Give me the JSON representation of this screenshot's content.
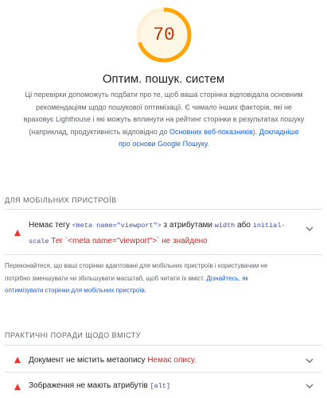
{
  "gauge": {
    "score": "70",
    "score_fraction": 0.7,
    "color": "#ffa400"
  },
  "category": {
    "title": "Оптим. пошук. систем",
    "description_before_link": "Ці перевірки допоможуть подбати про те, щоб ваша сторінка відповідала основним рекомендаціям щодо пошукової оптимізації. Є чимало інших факторів, які не враховує Lighthouse і які можуть вплинути на рейтинг сторінки в результатах пошуку (наприклад, продуктивність відповідно до ",
    "link_vitals": "Основних веб-показників",
    "description_middle": "). ",
    "link_google": "Докладніше про основи Google Пошуку",
    "description_end": "."
  },
  "mobile_group": {
    "header": "ДЛЯ МОБІЛЬНИХ ПРИСТРОЇВ",
    "audit": {
      "text1": "Немає тегу ",
      "code1": "<meta name=\"viewport\">",
      "text2": " з атрибутами ",
      "code2": "width",
      "text3": " або ",
      "code3": "initial-",
      "code4": "scale",
      "error": "Тег `<meta name=\"viewport\">` не знайдено"
    },
    "explanation": "Переконайтеся, що ваші сторінки адаптовані для мобільних пристроїв і користувачам не потрібно зменшувати чи збільшувати масштаб, щоб читати їх вміст. ",
    "explanation_link": "Дізнайтесь, як оптимізувати сторінки для мобільних пристроїв",
    "explanation_end": "."
  },
  "content_group": {
    "header": "ПРАКТИЧНІ ПОРАДИ ЩОДО ВМІСТУ",
    "audits": [
      {
        "title": "Документ не містить метаопису",
        "error": "Немає опису."
      },
      {
        "title": "Зображення не мають атрибутів",
        "code": "[alt]"
      }
    ]
  }
}
